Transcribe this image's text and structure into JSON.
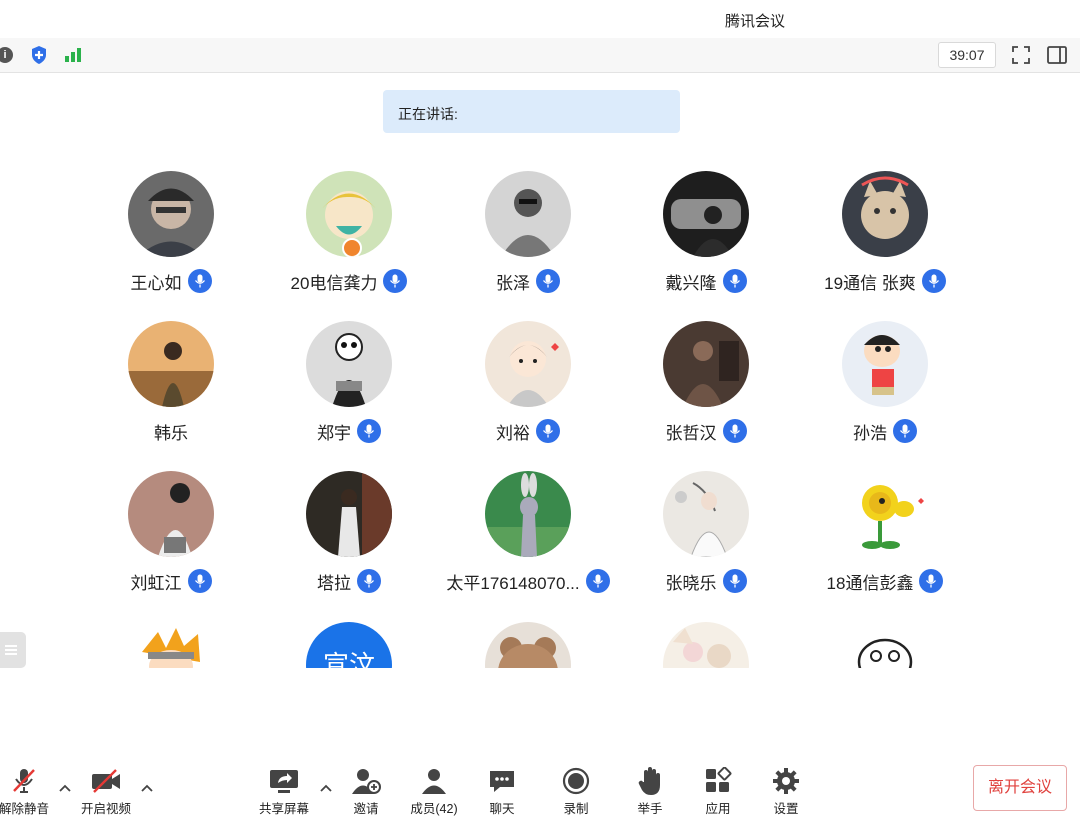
{
  "window": {
    "title": "腾讯会议"
  },
  "toolbar": {
    "info_icon": "info-icon",
    "shield_icon": "shield-icon",
    "signal_icon": "signal-icon",
    "timer": "39:07"
  },
  "speaking": {
    "label": "正在讲话:"
  },
  "participants": [
    {
      "name": "王心如",
      "mic": true
    },
    {
      "name": "20电信龚力",
      "mic": true,
      "host": true
    },
    {
      "name": "张泽",
      "mic": true
    },
    {
      "name": "戴兴隆",
      "mic": true
    },
    {
      "name": "19通信 张爽",
      "mic": true
    },
    {
      "name": "韩乐",
      "mic": false
    },
    {
      "name": "郑宇",
      "mic": true
    },
    {
      "name": "刘裕",
      "mic": true
    },
    {
      "name": "张哲汉",
      "mic": true
    },
    {
      "name": "孙浩",
      "mic": true
    },
    {
      "name": "刘虹江",
      "mic": true
    },
    {
      "name": "塔拉",
      "mic": true
    },
    {
      "name": "太平176148070...",
      "mic": true
    },
    {
      "name": "张晓乐",
      "mic": true
    },
    {
      "name": "18通信彭鑫",
      "mic": true
    },
    {
      "name": "",
      "mic": false
    },
    {
      "name": "",
      "mic": false,
      "initials": "宣汶"
    },
    {
      "name": "",
      "mic": false
    },
    {
      "name": "",
      "mic": false
    },
    {
      "name": "",
      "mic": false
    }
  ],
  "bottom": {
    "unmute": "解除静音",
    "video": "开启视频",
    "share": "共享屏幕",
    "invite": "邀请",
    "members": "成员(42)",
    "chat": "聊天",
    "record": "录制",
    "raise_hand": "举手",
    "apps": "应用",
    "settings": "设置",
    "leave": "离开会议"
  },
  "colors": {
    "accent": "#2f6fe8",
    "speaking_bg": "#dcebfb",
    "leave": "#e0413d"
  }
}
